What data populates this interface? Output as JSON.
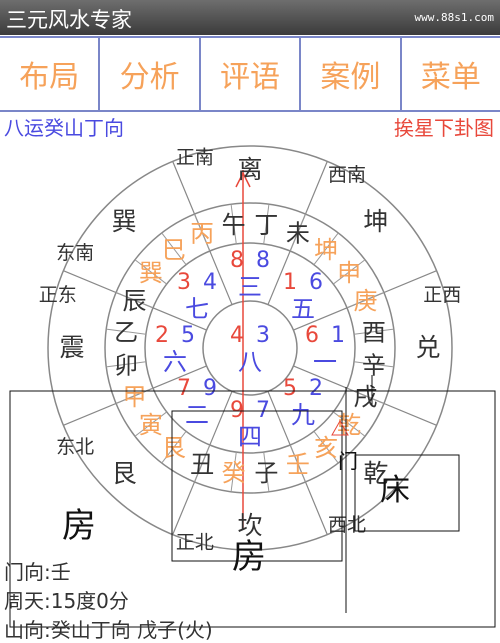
{
  "header": {
    "title": "三元风水专家",
    "watermark": "www.88s1.com"
  },
  "tabs": [
    {
      "label": "布局"
    },
    {
      "label": "分析"
    },
    {
      "label": "评语"
    },
    {
      "label": "案例"
    },
    {
      "label": "菜单"
    }
  ],
  "chart_info": {
    "title": "八运癸山丁向",
    "mode": "挨星下卦图"
  },
  "directions": [
    "离",
    "西南",
    "坤",
    "兑",
    "正西",
    "西北",
    "乾",
    "正北",
    "坎",
    "东北",
    "艮",
    "正东",
    "震",
    "东南",
    "巽",
    "正南"
  ],
  "mountains": [
    "午",
    "丁",
    "未",
    "坤",
    "申",
    "庚",
    "酉",
    "辛",
    "戌",
    "乾",
    "亥",
    "壬",
    "子",
    "癸",
    "丑",
    "艮",
    "寅",
    "甲",
    "卯",
    "乙",
    "辰",
    "巽",
    "巳",
    "丙"
  ],
  "palaces": [
    {
      "trigram": "三",
      "mountain_star": "8",
      "water_star": "8"
    },
    {
      "trigram": "五",
      "mountain_star": "1",
      "water_star": "6"
    },
    {
      "trigram": "一",
      "mountain_star": "6",
      "water_star": "1"
    },
    {
      "trigram": "八",
      "mountain_star": "4",
      "water_star": "3"
    },
    {
      "trigram": "九",
      "mountain_star": "5",
      "water_star": "2"
    },
    {
      "trigram": "四",
      "mountain_star": "9",
      "water_star": "7"
    },
    {
      "trigram": "二",
      "mountain_star": "7",
      "water_star": "9"
    },
    {
      "trigram": "六",
      "mountain_star": "2",
      "water_star": "5"
    },
    {
      "trigram": "七",
      "mountain_star": "3",
      "water_star": "4"
    }
  ],
  "sketch_labels": {
    "house1": "房",
    "house2": "房",
    "bed": "床",
    "door": "门"
  },
  "bottom": {
    "line1": "门向:壬",
    "line2": "周天:15度0分",
    "line3": "山向:癸山丁向 戊子(火)"
  }
}
